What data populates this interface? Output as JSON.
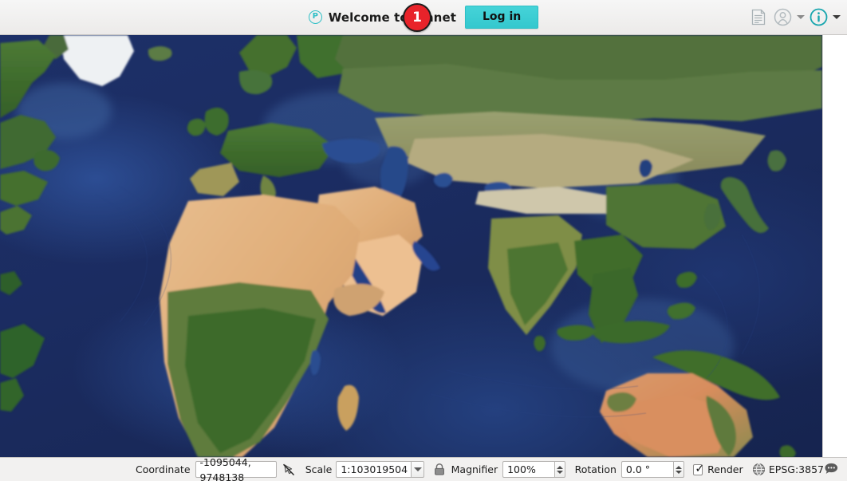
{
  "window": {
    "app_kind": "qgis-desktop-gis"
  },
  "topbar": {
    "logo_letter": "P",
    "logo_icon": "planet-circle-p-icon",
    "welcome_text": "Welcome to Planet",
    "login_label": "Log in",
    "step_badge": "1",
    "right_icons": [
      {
        "name": "messages-log-icon",
        "glyph": "document-lines"
      },
      {
        "name": "user-profile-icon",
        "glyph": "person-circle"
      },
      {
        "name": "profile-dropdown-caret-icon",
        "glyph": "caret-down"
      },
      {
        "name": "info-icon",
        "glyph": "i-circle"
      },
      {
        "name": "info-dropdown-caret-icon",
        "glyph": "caret-down"
      }
    ]
  },
  "map": {
    "basemap_name": "satellite-blue-marble",
    "ocean_color": "#1b2c61",
    "deep_ocean_color": "#16244f",
    "shelf_color": "#3e639f",
    "vegetation_color": "#3f6b2e",
    "desert_color": "#e3b183",
    "ice_color": "#f2f4f6"
  },
  "statusbar": {
    "coordinate_label": "Coordinate",
    "coordinate_value": "-1095044, 9748138",
    "coordinate_toggle_icon": "coordinate-capture-off-icon",
    "scale_label": "Scale",
    "scale_value": "1:103019504",
    "scale_dropdown_icon": "caret-down-icon",
    "lock_icon": "scale-lock-icon",
    "magnifier_label": "Magnifier",
    "magnifier_value": "100%",
    "rotation_label": "Rotation",
    "rotation_value": "0.0 °",
    "render_label": "Render",
    "render_checked": true,
    "crs_icon": "globe-crs-icon",
    "crs_label": "EPSG:3857",
    "messages_icon": "messages-bubble-icon"
  },
  "colors": {
    "accent_teal": "#3bcfd4",
    "badge_red": "#e8232a",
    "chrome_gray": "#f2f1f0"
  }
}
